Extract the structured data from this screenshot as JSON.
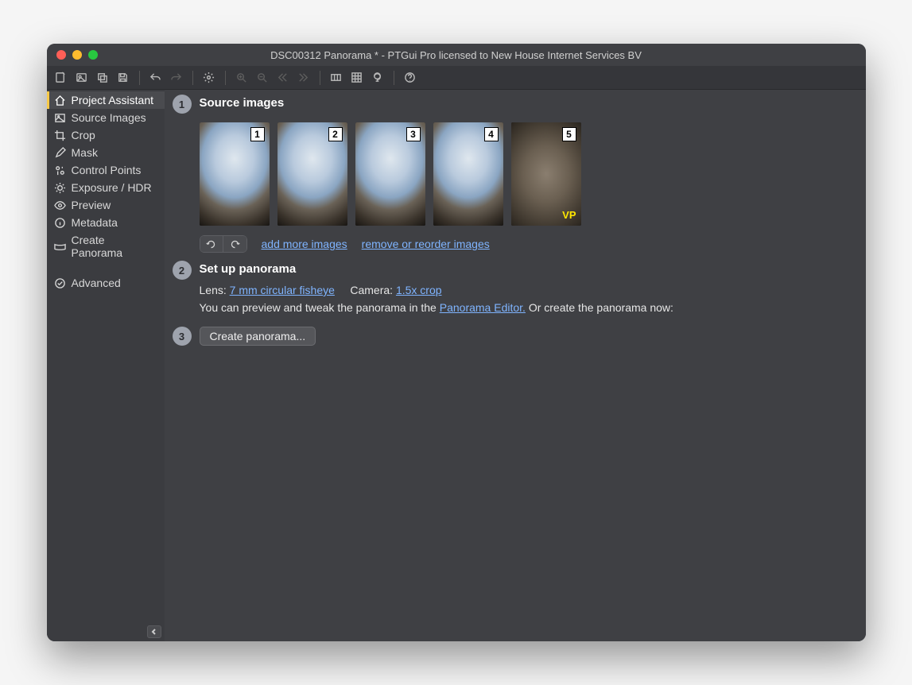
{
  "window": {
    "title": "DSC00312 Panorama * - PTGui Pro licensed to New House Internet Services BV"
  },
  "sidebar": {
    "items": [
      {
        "label": "Project Assistant",
        "icon": "home",
        "active": true
      },
      {
        "label": "Source Images",
        "icon": "images",
        "active": false
      },
      {
        "label": "Crop",
        "icon": "crop",
        "active": false
      },
      {
        "label": "Mask",
        "icon": "brush",
        "active": false
      },
      {
        "label": "Control Points",
        "icon": "pins",
        "active": false
      },
      {
        "label": "Exposure / HDR",
        "icon": "sun",
        "active": false
      },
      {
        "label": "Preview",
        "icon": "eye",
        "active": false
      },
      {
        "label": "Metadata",
        "icon": "info",
        "active": false
      },
      {
        "label": "Create Panorama",
        "icon": "pano",
        "active": false
      }
    ],
    "advanced": {
      "label": "Advanced",
      "icon": "check"
    }
  },
  "steps": {
    "s1": {
      "num": "1",
      "title": "Source images",
      "thumbs": [
        {
          "num": "1",
          "vp": false
        },
        {
          "num": "2",
          "vp": false
        },
        {
          "num": "3",
          "vp": false
        },
        {
          "num": "4",
          "vp": false
        },
        {
          "num": "5",
          "vp": true
        }
      ],
      "vp_label": "VP",
      "add_link": "add more images",
      "remove_link": "remove or reorder images"
    },
    "s2": {
      "num": "2",
      "title": "Set up panorama",
      "lens_label": "Lens:",
      "lens_value": "7 mm circular fisheye",
      "camera_label": "Camera:",
      "camera_value": "1.5x crop",
      "preview_text_pre": "You can preview and tweak the panorama in the ",
      "preview_link": "Panorama Editor.",
      "preview_text_post": " Or create the panorama now:"
    },
    "s3": {
      "num": "3",
      "button": "Create panorama..."
    }
  }
}
